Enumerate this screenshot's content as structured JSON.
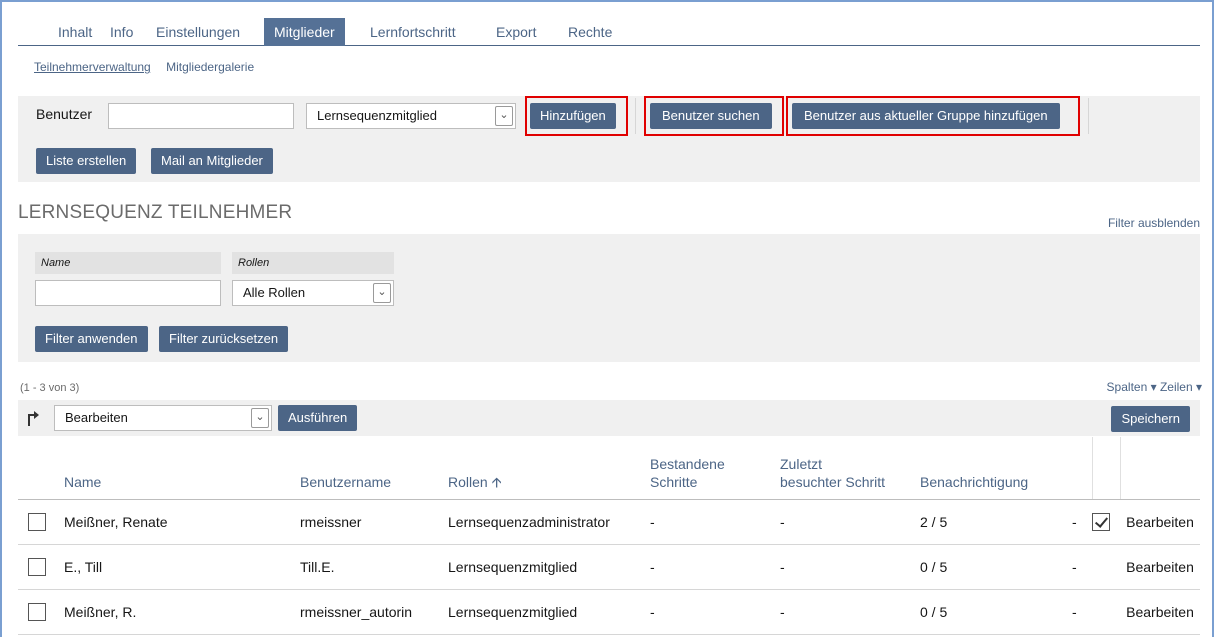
{
  "tabs": [
    "Inhalt",
    "Info",
    "Einstellungen",
    "Mitglieder",
    "Lernfortschritt",
    "Export",
    "Rechte"
  ],
  "active_tab": "Mitglieder",
  "subtabs": [
    "Teilnehmerverwaltung",
    "Mitgliedergalerie"
  ],
  "toolbar": {
    "user_label": "Benutzer",
    "user_value": "",
    "role_select": "Lernsequenzmitglied",
    "add_button": "Hinzufügen",
    "search_button": "Benutzer suchen",
    "add_group_button": "Benutzer aus aktueller Gruppe hinzufügen",
    "list_button": "Liste erstellen",
    "mail_button": "Mail an Mitglieder"
  },
  "section_title": "LERNSEQUENZ TEILNEHMER",
  "filter_toggle": "Filter ausblenden",
  "filter": {
    "name_label": "Name",
    "name_value": "",
    "roles_label": "Rollen",
    "roles_value": "Alle Rollen",
    "apply_button": "Filter anwenden",
    "reset_button": "Filter zurücksetzen"
  },
  "table_info": {
    "count": "(1 - 3 von 3)",
    "columns_link": "Spalten ▾",
    "rows_link": "Zeilen ▾"
  },
  "actions": {
    "select_value": "Bearbeiten",
    "execute_button": "Ausführen",
    "save_button": "Speichern"
  },
  "columns": {
    "name": "Name",
    "username": "Benutzername",
    "roles": "Rollen",
    "passed_1": "Bestandene",
    "passed_2": "Schritte",
    "last_1": "Zuletzt",
    "last_2": "besuchter Schritt",
    "notification": "Benachrichtigung"
  },
  "rows": [
    {
      "name": "Meißner, Renate",
      "username": "rmeissner",
      "role": "Lernsequenzadministrator",
      "passed": "-",
      "last": "-",
      "progress": "2 / 5",
      "notify": "-",
      "notify_checked": true,
      "edit": "Bearbeiten"
    },
    {
      "name": "E., Till",
      "username": "Till.E.",
      "role": "Lernsequenzmitglied",
      "passed": "-",
      "last": "-",
      "progress": "0 / 5",
      "notify": "-",
      "notify_checked": false,
      "edit": "Bearbeiten"
    },
    {
      "name": "Meißner, R.",
      "username": "rmeissner_autorin",
      "role": "Lernsequenzmitglied",
      "passed": "-",
      "last": "-",
      "progress": "0 / 5",
      "notify": "-",
      "notify_checked": false,
      "edit": "Bearbeiten"
    }
  ],
  "colors": {
    "primary": "#4c6586",
    "highlight": "#e00000",
    "panel": "#f0f0f0"
  }
}
